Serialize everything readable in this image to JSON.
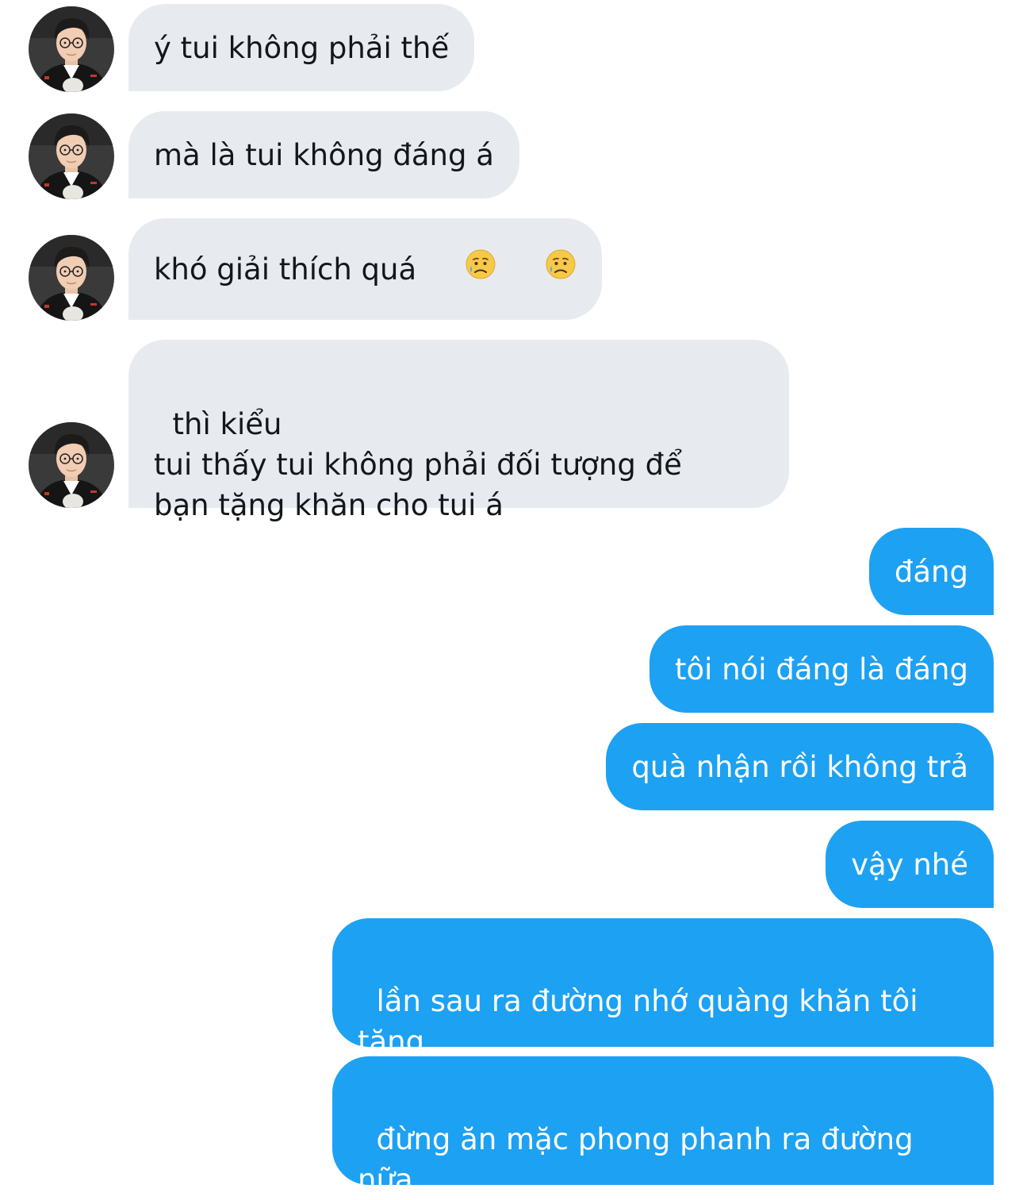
{
  "conversation": {
    "received": [
      {
        "text": "ý tui không phải thế"
      },
      {
        "text": "mà là tui không đáng á"
      },
      {
        "text": "khó giải thích quá",
        "emoji": [
          "sad-but-relieved-face-emoji",
          "sad-but-relieved-face-emoji"
        ]
      },
      {
        "text": "thì kiểu\ntui thấy tui không phải đối tượng để\nbạn tặng khăn cho tui á"
      }
    ],
    "sent": [
      {
        "text": "đáng"
      },
      {
        "text": "tôi nói đáng là đáng"
      },
      {
        "text": "quà nhận rồi không trả"
      },
      {
        "text": "vậy nhé"
      },
      {
        "text": "lần sau ra đường nhớ quàng khăn tôi\ntặng"
      },
      {
        "text": "đừng ăn mặc phong phanh ra đường\nnữa"
      }
    ]
  },
  "colors": {
    "received_bubble": "#e7ebef",
    "sent_bubble": "#1da1f2",
    "received_text": "#14171a",
    "sent_text": "#ffffff"
  }
}
